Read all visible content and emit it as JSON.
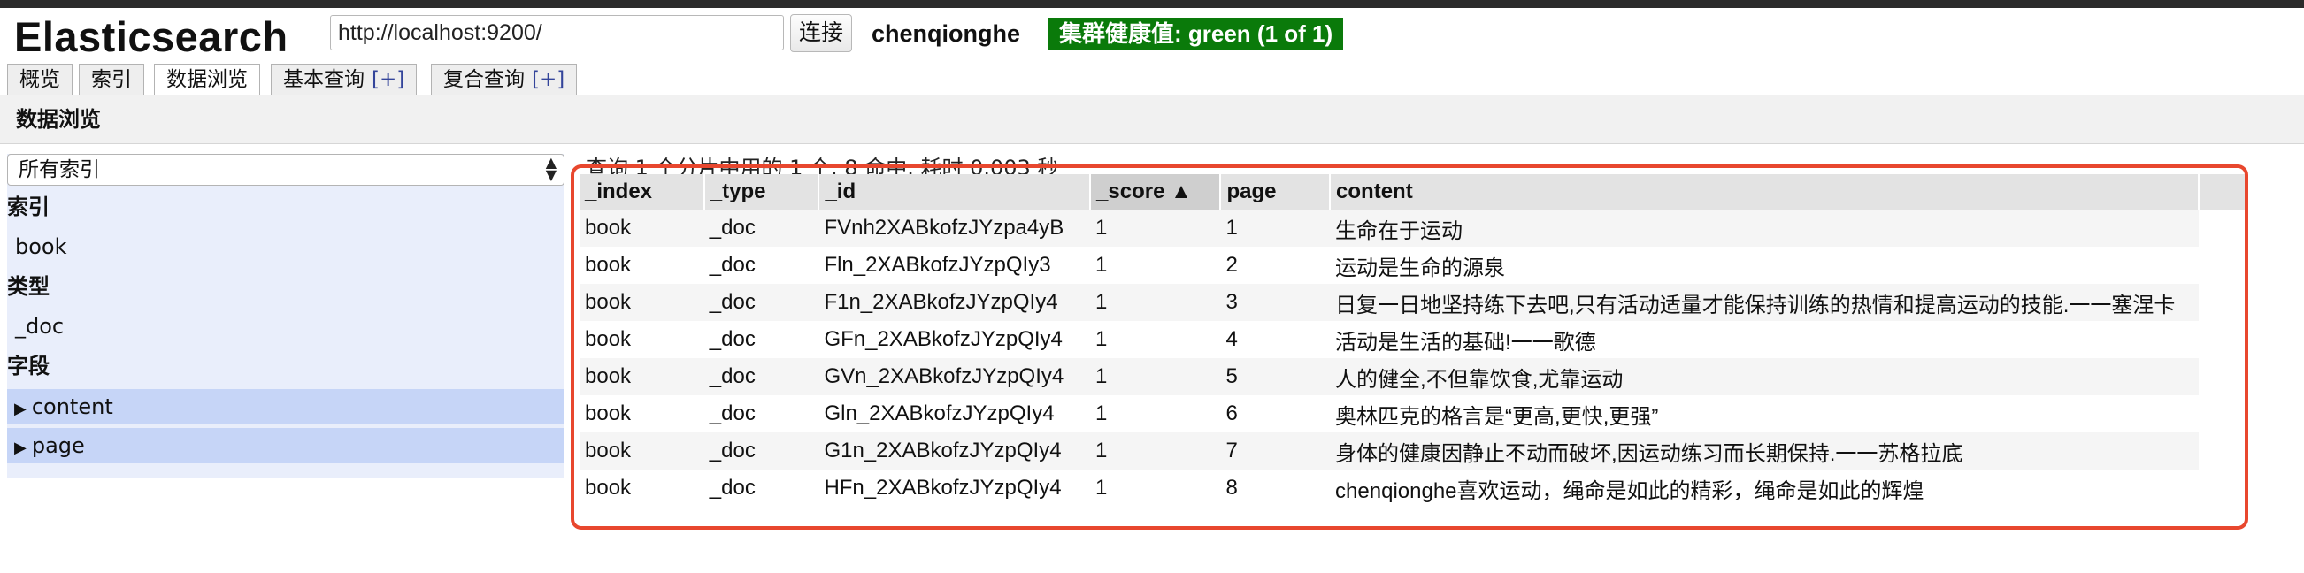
{
  "app": {
    "title": "Elasticsearch",
    "url": "http://localhost:9200/",
    "connect_label": "连接",
    "cluster_name": "chenqionghe",
    "health": "集群健康值: green (1 of 1)",
    "health_color": "#0a7a0a"
  },
  "tabs": [
    {
      "label": "概览"
    },
    {
      "label": "索引"
    },
    {
      "label": "数据浏览"
    },
    {
      "label": "基本查询",
      "extra": "[+]"
    },
    {
      "label": "复合查询",
      "extra": "[+]"
    }
  ],
  "subbar": {
    "title": "数据浏览"
  },
  "sidebar": {
    "index_select": "所有索引",
    "index_heading": "索引",
    "index_item": "book",
    "type_heading": "类型",
    "type_item": "_doc",
    "field_heading": "字段",
    "fields": [
      "content",
      "page"
    ]
  },
  "results": {
    "summary": "查询 1 个分片中用的 1 个. 8 命中. 耗时 0.003 秒",
    "columns": [
      "_index",
      "_type",
      "_id",
      "_score ▲",
      "page",
      "content"
    ],
    "rows": [
      [
        "book",
        "_doc",
        "FVnh2XABkofzJYzpa4yB",
        "1",
        "1",
        "生命在于运动"
      ],
      [
        "book",
        "_doc",
        "Fln_2XABkofzJYzpQIy3",
        "1",
        "2",
        "运动是生命的源泉"
      ],
      [
        "book",
        "_doc",
        "F1n_2XABkofzJYzpQIy4",
        "1",
        "3",
        "日复一日地坚持练下去吧,只有活动适量才能保持训练的热情和提高运动的技能.一一塞涅卡"
      ],
      [
        "book",
        "_doc",
        "GFn_2XABkofzJYzpQIy4",
        "1",
        "4",
        "活动是生活的基础!一一歌德"
      ],
      [
        "book",
        "_doc",
        "GVn_2XABkofzJYzpQIy4",
        "1",
        "5",
        "人的健全,不但靠饮食,尤靠运动"
      ],
      [
        "book",
        "_doc",
        "Gln_2XABkofzJYzpQIy4",
        "1",
        "6",
        "奥林匹克的格言是“更高,更快,更强”"
      ],
      [
        "book",
        "_doc",
        "G1n_2XABkofzJYzpQIy4",
        "1",
        "7",
        "身体的健康因静止不动而破坏,因运动练习而长期保持.一一苏格拉底"
      ],
      [
        "book",
        "_doc",
        "HFn_2XABkofzJYzpQIy4",
        "1",
        "8",
        "chenqionghe喜欢运动，绳命是如此的精彩，绳命是如此的辉煌"
      ]
    ]
  }
}
